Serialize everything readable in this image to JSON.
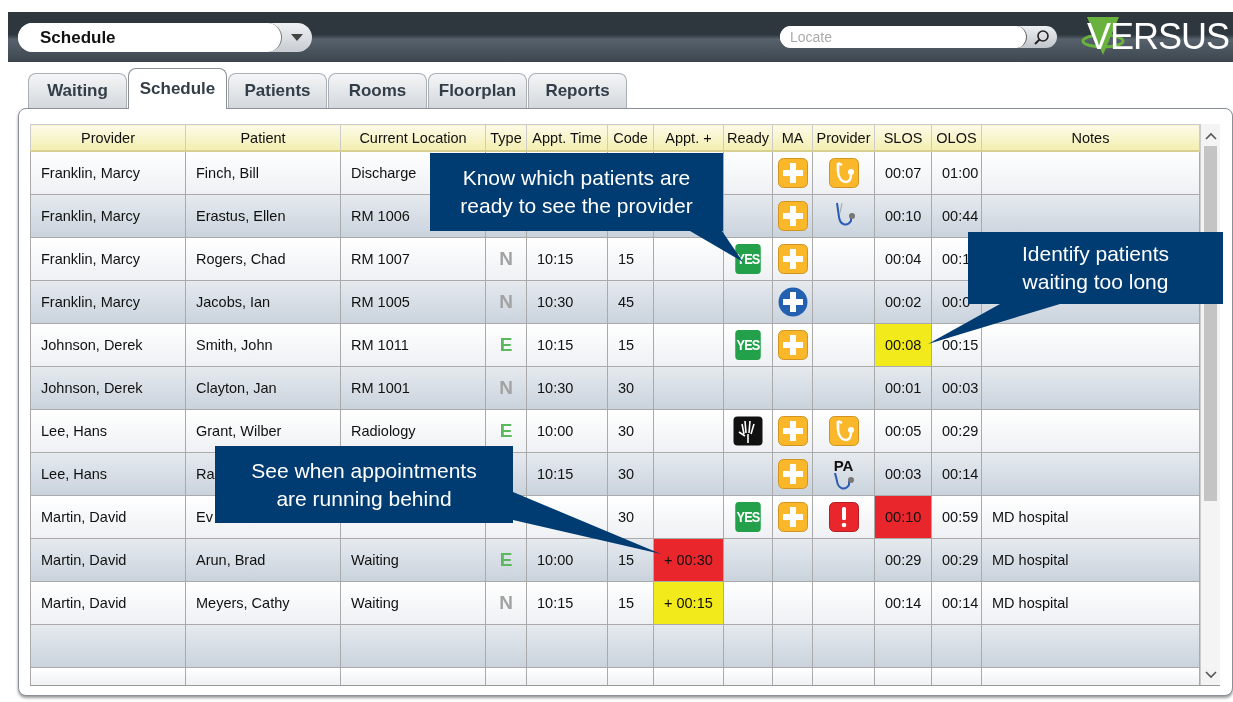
{
  "top_bar": {
    "view_select": {
      "value": "Schedule"
    },
    "search": {
      "placeholder": "Locate"
    },
    "logo": "VERSUS"
  },
  "tabs": [
    {
      "label": "Waiting",
      "selected": false
    },
    {
      "label": "Schedule",
      "selected": true
    },
    {
      "label": "Patients",
      "selected": false
    },
    {
      "label": "Rooms",
      "selected": false
    },
    {
      "label": "Floorplan",
      "selected": false
    },
    {
      "label": "Reports",
      "selected": false
    }
  ],
  "table": {
    "columns": [
      "Provider",
      "Patient",
      "Current Location",
      "Type",
      "Appt. Time",
      "Code",
      "Appt. +",
      "Ready",
      "MA",
      "Provider",
      "SLOS",
      "OLOS",
      "Notes"
    ],
    "rows": [
      {
        "provider": "Franklin, Marcy",
        "patient": "Finch, Bill",
        "location": "Discharge",
        "ma": {
          "kind": "square"
        },
        "provider_icon": {
          "kind": "badge"
        },
        "slos": "00:07",
        "olos": "01:00"
      },
      {
        "provider": "Franklin, Marcy",
        "patient": "Erastus, Ellen",
        "location": "RM 1006",
        "ma": {
          "kind": "square"
        },
        "provider_icon": {
          "kind": "plain"
        },
        "slos": "00:10",
        "olos": "00:44"
      },
      {
        "provider": "Franklin, Marcy",
        "patient": "Rogers, Chad",
        "location": "RM 1007",
        "type": {
          "letter": "N",
          "color": "#a3a3a3"
        },
        "time": "10:15",
        "code": "15",
        "ready": {
          "kind": "yes",
          "text": "YES"
        },
        "ma": {
          "kind": "square"
        },
        "slos": "00:04",
        "olos": "00:1"
      },
      {
        "provider": "Franklin, Marcy",
        "patient": "Jacobs, Ian",
        "location": "RM 1005",
        "type": {
          "letter": "N",
          "color": "#a3a3a3"
        },
        "time": "10:30",
        "code": "45",
        "ma": {
          "kind": "round"
        },
        "slos": "00:02",
        "olos": "00:0"
      },
      {
        "provider": "Johnson, Derek",
        "patient": "Smith, John",
        "location": "RM 1011",
        "type": {
          "letter": "E",
          "color": "#5cb85c"
        },
        "time": "10:15",
        "code": "15",
        "ready": {
          "kind": "yes",
          "text": "YES"
        },
        "ma": {
          "kind": "square"
        },
        "slos": "00:08",
        "slos_highlight": {
          "color": "#f2ea1b"
        },
        "olos": "00:15"
      },
      {
        "provider": "Johnson, Derek",
        "patient": "Clayton, Jan",
        "location": "RM 1001",
        "type": {
          "letter": "N",
          "color": "#a3a3a3"
        },
        "time": "10:30",
        "code": "30",
        "slos": "00:01",
        "olos": "00:03"
      },
      {
        "provider": "Lee, Hans",
        "patient": "Grant, Wilber",
        "location": "Radiology",
        "type": {
          "letter": "E",
          "color": "#5cb85c"
        },
        "time": "10:00",
        "code": "30",
        "ready": {
          "kind": "xray"
        },
        "ma": {
          "kind": "square"
        },
        "provider_icon": {
          "kind": "badge"
        },
        "slos": "00:05",
        "olos": "00:29"
      },
      {
        "provider": "Lee, Hans",
        "patient": "Ra",
        "time": "10:15",
        "code": "30",
        "ma": {
          "kind": "square"
        },
        "provider_icon": {
          "kind": "pa",
          "text": "PA"
        },
        "slos": "00:03",
        "olos": "00:14"
      },
      {
        "provider": "Martin, David",
        "patient": "Ev",
        "code": "30",
        "ready": {
          "kind": "yes",
          "text": "YES"
        },
        "ma": {
          "kind": "square"
        },
        "provider_icon": {
          "kind": "alert"
        },
        "slos": "00:10",
        "slos_highlight": {
          "color": "#e8262c"
        },
        "olos": "00:59",
        "notes": "MD hospital"
      },
      {
        "provider": "Martin, David",
        "patient": "Arun, Brad",
        "location": "Waiting",
        "type": {
          "letter": "E",
          "color": "#5cb85c"
        },
        "time": "10:00",
        "code": "15",
        "appt_plus": "+ 00:30",
        "appt_plus_highlight": {
          "color": "#e8262c"
        },
        "slos": "00:29",
        "olos": "00:29",
        "notes": "MD hospital"
      },
      {
        "provider": "Martin, David",
        "patient": "Meyers, Cathy",
        "location": "Waiting",
        "type": {
          "letter": "N",
          "color": "#a3a3a3"
        },
        "time": "10:15",
        "code": "15",
        "appt_plus": "+ 00:15",
        "appt_plus_highlight": {
          "color": "#f2ea1b"
        },
        "slos": "00:14",
        "olos": "00:14",
        "notes": "MD hospital"
      }
    ]
  },
  "callouts": [
    {
      "text": "Know which patients are ready to see the provider"
    },
    {
      "text": "Identify patients waiting too long"
    },
    {
      "text": "See when appointments are running behind"
    }
  ]
}
